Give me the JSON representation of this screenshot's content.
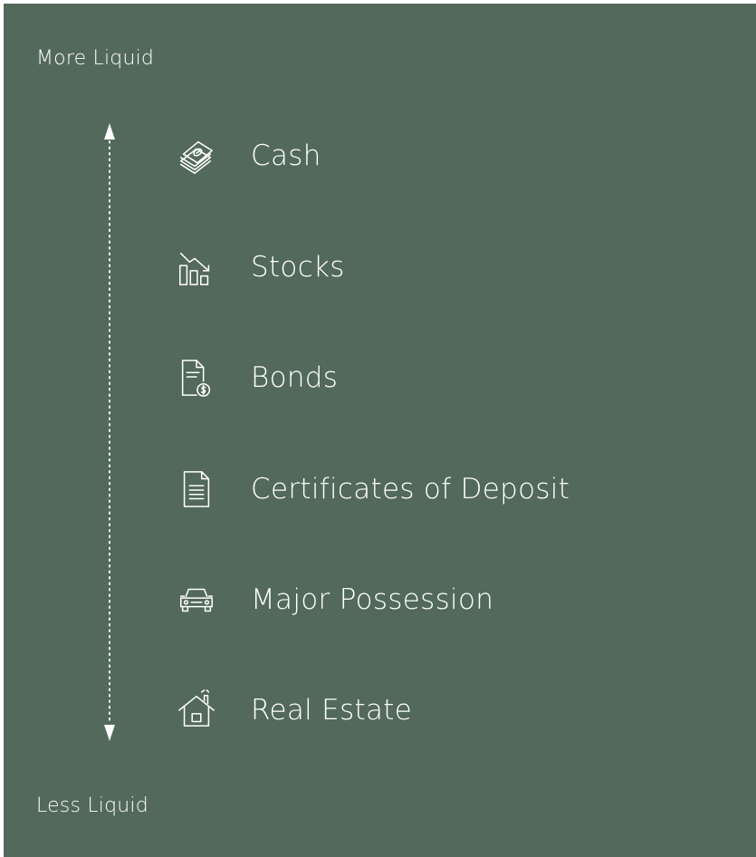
{
  "diagram": {
    "top_label": "More Liquid",
    "bottom_label": "Less Liquid",
    "background": "#53695b",
    "items": [
      {
        "label": "Cash",
        "icon": "cash-icon"
      },
      {
        "label": "Stocks",
        "icon": "stocks-icon"
      },
      {
        "label": "Bonds",
        "icon": "bond-document-icon"
      },
      {
        "label": "Certificates of Deposit",
        "icon": "document-icon"
      },
      {
        "label": "Major Possession",
        "icon": "car-icon"
      },
      {
        "label": "Real Estate",
        "icon": "house-icon"
      }
    ]
  }
}
